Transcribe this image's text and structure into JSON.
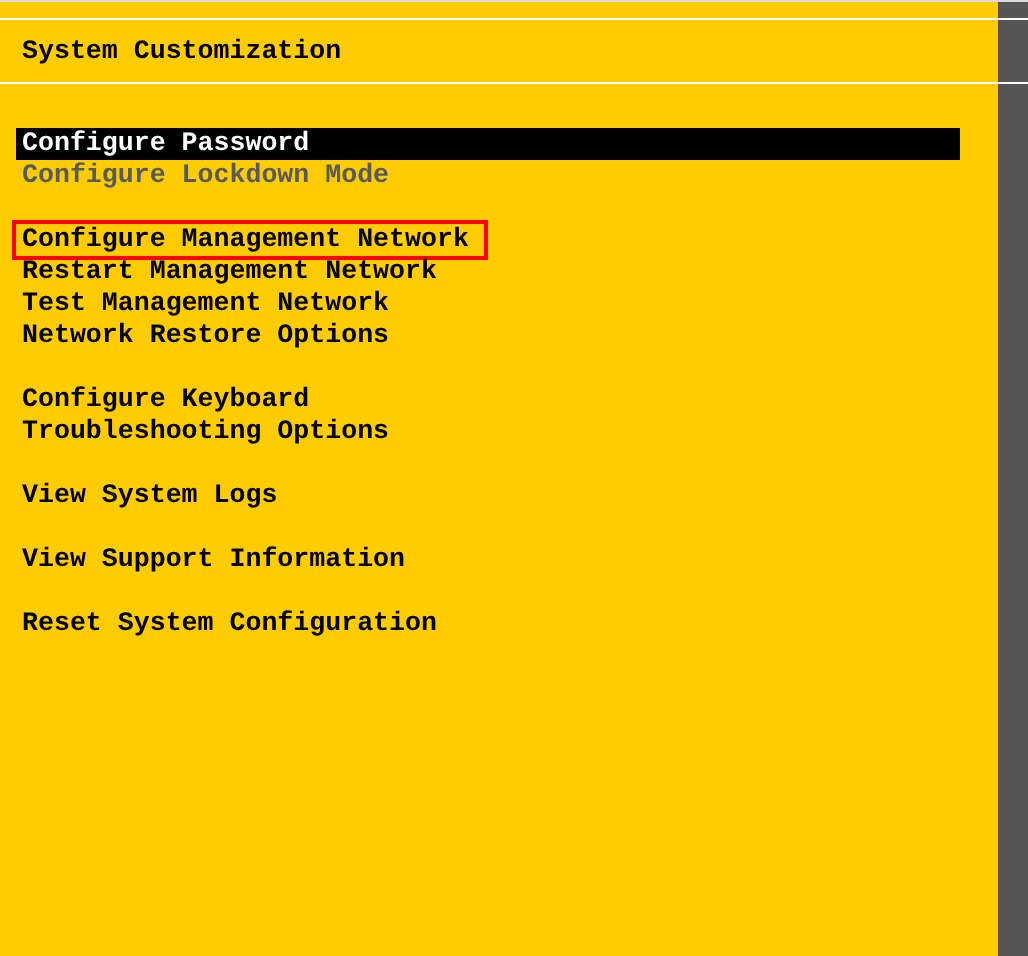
{
  "title": "System Customization",
  "menu_groups": [
    {
      "items": [
        {
          "label": "Configure Password",
          "selected": true,
          "disabled": false,
          "highlighted": false
        },
        {
          "label": "Configure Lockdown Mode",
          "selected": false,
          "disabled": true,
          "highlighted": false
        }
      ]
    },
    {
      "items": [
        {
          "label": "Configure Management Network",
          "selected": false,
          "disabled": false,
          "highlighted": true
        },
        {
          "label": "Restart Management Network",
          "selected": false,
          "disabled": false,
          "highlighted": false
        },
        {
          "label": "Test Management Network",
          "selected": false,
          "disabled": false,
          "highlighted": false
        },
        {
          "label": "Network Restore Options",
          "selected": false,
          "disabled": false,
          "highlighted": false
        }
      ]
    },
    {
      "items": [
        {
          "label": "Configure Keyboard",
          "selected": false,
          "disabled": false,
          "highlighted": false
        },
        {
          "label": "Troubleshooting Options",
          "selected": false,
          "disabled": false,
          "highlighted": false
        }
      ]
    },
    {
      "items": [
        {
          "label": "View System Logs",
          "selected": false,
          "disabled": false,
          "highlighted": false
        }
      ]
    },
    {
      "items": [
        {
          "label": "View Support Information",
          "selected": false,
          "disabled": false,
          "highlighted": false
        }
      ]
    },
    {
      "items": [
        {
          "label": "Reset System Configuration",
          "selected": false,
          "disabled": false,
          "highlighted": false
        }
      ]
    }
  ]
}
